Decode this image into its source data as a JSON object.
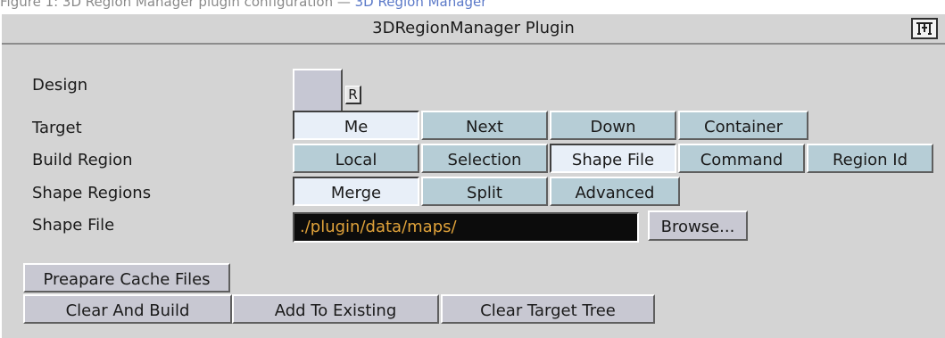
{
  "caption": {
    "prefix": "Figure 1: 3D Region Manager plugin configuration — ",
    "link": "3D Region Manager"
  },
  "window": {
    "title": "3DRegionManager Plugin",
    "icon": "plugin-logo-icon"
  },
  "design": {
    "label": "Design",
    "reset_label": "R",
    "swatch_color": "#c6c7d3"
  },
  "target": {
    "label": "Target",
    "options": [
      "Me",
      "Next",
      "Down",
      "Container"
    ],
    "selected": "Me"
  },
  "build_region": {
    "label": "Build Region",
    "options": [
      "Local",
      "Selection",
      "Shape File",
      "Command",
      "Region Id"
    ],
    "selected": "Shape File"
  },
  "shape_regions": {
    "label": "Shape Regions",
    "options": [
      "Merge",
      "Split",
      "Advanced"
    ],
    "selected": "Merge"
  },
  "shape_file": {
    "label": "Shape File",
    "value": "./plugin/data/maps/",
    "browse_label": "Browse..."
  },
  "actions": {
    "prepare_cache": "Preapare Cache Files",
    "clear_and_build": "Clear And Build",
    "add_to_existing": "Add To Existing",
    "clear_target_tree": "Clear Target Tree"
  },
  "colors": {
    "panel": "#d4d4d4",
    "button": "#b6cdd6",
    "selected_button": "#e8eff8",
    "path_text": "#e0a23a",
    "path_bg": "#0c0c0c"
  }
}
